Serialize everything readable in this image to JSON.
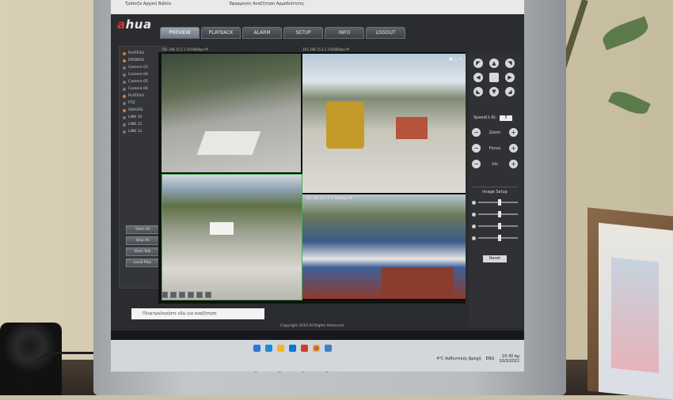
{
  "browser": {
    "tab_1": "Τράπεζα Αρχική Βιβλία",
    "tab_2": "Εφαρμογές Αναζήτηση Αρμοδιότητες"
  },
  "app": {
    "brand_prefix": "a",
    "brand_suffix": "hua",
    "tabs": [
      "PREVIEW",
      "PLAYBACK",
      "ALARM",
      "SETUP",
      "INFO",
      "LOGOUT"
    ],
    "active_tab": "PREVIEW"
  },
  "cameras": [
    {
      "label": "PLATEAU",
      "on": true
    },
    {
      "label": "DRONOS",
      "on": true
    },
    {
      "label": "Camera 03",
      "on": false
    },
    {
      "label": "Camera 04",
      "on": false
    },
    {
      "label": "Camera 05",
      "on": false
    },
    {
      "label": "Camera 06",
      "on": false
    },
    {
      "label": "PLATEAU",
      "on": true
    },
    {
      "label": "PTZ",
      "on": false
    },
    {
      "label": "ODIGOS",
      "on": true
    },
    {
      "label": "LINK 10",
      "on": false
    },
    {
      "label": "LINK 11",
      "on": false
    },
    {
      "label": "LINK 12",
      "on": false
    }
  ],
  "left_buttons": [
    "Start All",
    "Stop All",
    "Start Talk",
    "Local Play"
  ],
  "video": {
    "cam1_header": "192.168.15.2 1 04168kbps M",
    "cam2_header": "192.168.15.2 2 24568kbps M",
    "cam4_header": "192.168.15.2 4 37968kbps M"
  },
  "ptz": {
    "speed_label": "Speed(1-8):",
    "speed_value": "5",
    "zoom": "Zoom",
    "focus": "Focus",
    "iris": "Iris"
  },
  "image_setup": {
    "title": "Image Setup",
    "reset": "Reset"
  },
  "footer": {
    "search_placeholder": "Πληκτρολογήστε εδώ για αναζήτηση",
    "copyright": "Copyright 2010 All Rights Reserved.",
    "weather": "4°C Αυθεντικός βροχή",
    "lang": "ENG",
    "time": "10:30 πμ",
    "date": "10/3/2022"
  }
}
